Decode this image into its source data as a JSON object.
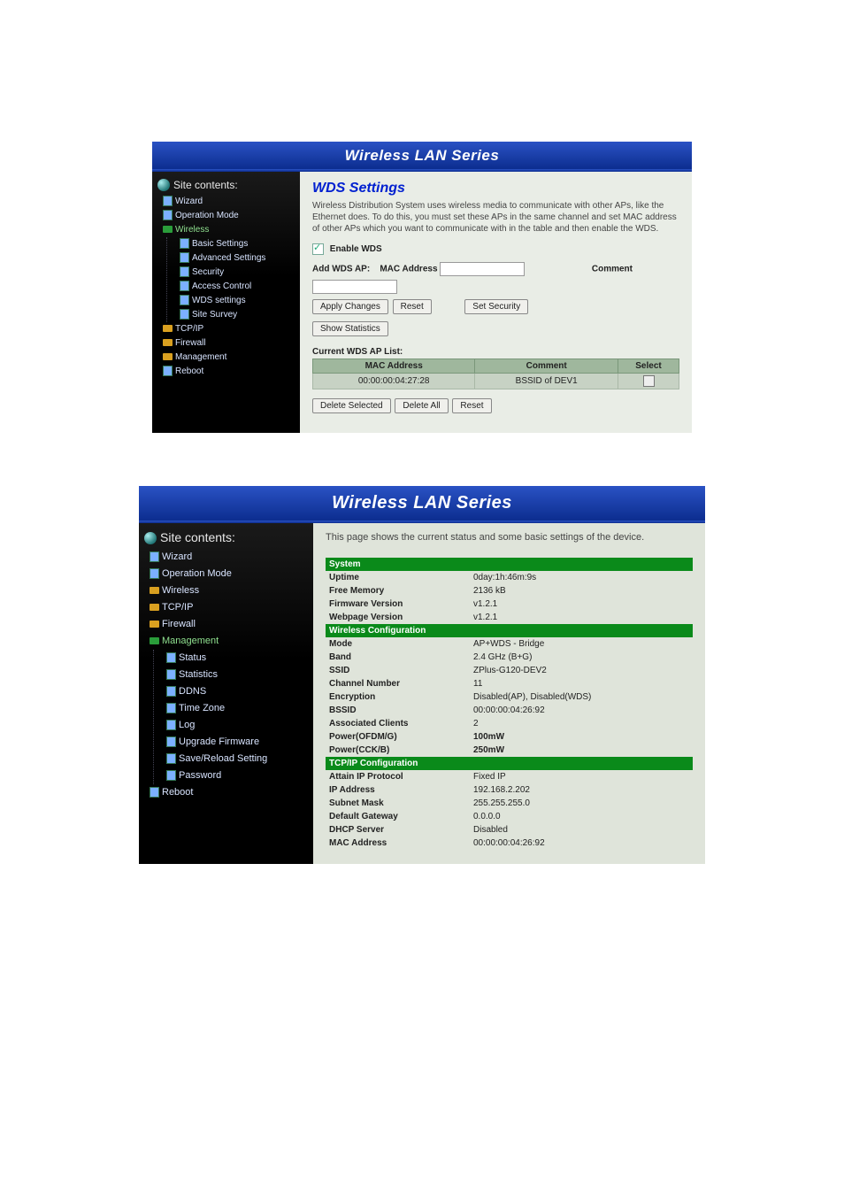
{
  "header": {
    "title": "Wireless LAN Series"
  },
  "wds": {
    "sidebar": {
      "header": "Site contents:",
      "items": [
        {
          "label": "Wizard",
          "kind": "doc"
        },
        {
          "label": "Operation Mode",
          "kind": "doc"
        },
        {
          "label": "Wireless",
          "kind": "folder-green",
          "children": [
            {
              "label": "Basic Settings",
              "kind": "doc"
            },
            {
              "label": "Advanced Settings",
              "kind": "doc"
            },
            {
              "label": "Security",
              "kind": "doc"
            },
            {
              "label": "Access Control",
              "kind": "doc"
            },
            {
              "label": "WDS settings",
              "kind": "doc"
            },
            {
              "label": "Site Survey",
              "kind": "doc"
            }
          ]
        },
        {
          "label": "TCP/IP",
          "kind": "folder"
        },
        {
          "label": "Firewall",
          "kind": "folder"
        },
        {
          "label": "Management",
          "kind": "folder"
        },
        {
          "label": "Reboot",
          "kind": "doc"
        }
      ]
    },
    "content": {
      "title": "WDS Settings",
      "description": "Wireless Distribution System uses wireless media to communicate with other APs, like the Ethernet does. To do this, you must set these APs in the same channel and set MAC address of other APs which you want to communicate with in the table and then enable the WDS.",
      "enable_label": "Enable WDS",
      "enable_checked": true,
      "add_label": "Add WDS AP:",
      "mac_label": "MAC Address",
      "comment_label": "Comment",
      "mac_value": "",
      "comment_value": "",
      "buttons": {
        "apply": "Apply Changes",
        "reset": "Reset",
        "security": "Set Security",
        "stats": "Show Statistics"
      },
      "list_title": "Current WDS AP List:",
      "table_headers": {
        "mac": "MAC Address",
        "comment": "Comment",
        "select": "Select"
      },
      "table_rows": [
        {
          "mac": "00:00:00:04:27:28",
          "comment": "BSSID of DEV1",
          "selected": false
        }
      ],
      "bottom_buttons": {
        "delete_selected": "Delete Selected",
        "delete_all": "Delete All",
        "reset": "Reset"
      }
    }
  },
  "status": {
    "sidebar": {
      "header": "Site contents:",
      "items": [
        {
          "label": "Wizard",
          "kind": "doc"
        },
        {
          "label": "Operation Mode",
          "kind": "doc"
        },
        {
          "label": "Wireless",
          "kind": "folder"
        },
        {
          "label": "TCP/IP",
          "kind": "folder"
        },
        {
          "label": "Firewall",
          "kind": "folder"
        },
        {
          "label": "Management",
          "kind": "folder-green",
          "children": [
            {
              "label": "Status",
              "kind": "doc"
            },
            {
              "label": "Statistics",
              "kind": "doc"
            },
            {
              "label": "DDNS",
              "kind": "doc"
            },
            {
              "label": "Time Zone",
              "kind": "doc"
            },
            {
              "label": "Log",
              "kind": "doc"
            },
            {
              "label": "Upgrade Firmware",
              "kind": "doc"
            },
            {
              "label": "Save/Reload Setting",
              "kind": "doc"
            },
            {
              "label": "Password",
              "kind": "doc"
            }
          ]
        },
        {
          "label": "Reboot",
          "kind": "doc"
        }
      ]
    },
    "content": {
      "intro": "This page shows the current status and some basic settings of the device.",
      "sections": [
        {
          "name": "System",
          "rows": [
            {
              "k": "Uptime",
              "v": "0day:1h:46m:9s"
            },
            {
              "k": "Free Memory",
              "v": "2136 kB"
            },
            {
              "k": "Firmware Version",
              "v": "v1.2.1"
            },
            {
              "k": "Webpage Version",
              "v": "v1.2.1"
            }
          ]
        },
        {
          "name": "Wireless Configuration",
          "rows": [
            {
              "k": "Mode",
              "v": "AP+WDS - Bridge"
            },
            {
              "k": "Band",
              "v": "2.4 GHz (B+G)"
            },
            {
              "k": "SSID",
              "v": "ZPlus-G120-DEV2"
            },
            {
              "k": "Channel Number",
              "v": "11"
            },
            {
              "k": "Encryption",
              "v": "Disabled(AP), Disabled(WDS)"
            },
            {
              "k": "BSSID",
              "v": "00:00:00:04:26:92"
            },
            {
              "k": "Associated Clients",
              "v": "2"
            },
            {
              "k": "Power(OFDM/G)",
              "v": "100mW",
              "bold": true
            },
            {
              "k": "Power(CCK/B)",
              "v": "250mW",
              "bold": true
            }
          ]
        },
        {
          "name": "TCP/IP Configuration",
          "rows": [
            {
              "k": "Attain IP Protocol",
              "v": "Fixed IP"
            },
            {
              "k": "IP Address",
              "v": "192.168.2.202"
            },
            {
              "k": "Subnet Mask",
              "v": "255.255.255.0"
            },
            {
              "k": "Default Gateway",
              "v": "0.0.0.0"
            },
            {
              "k": "DHCP Server",
              "v": "Disabled"
            },
            {
              "k": "MAC Address",
              "v": "00:00:00:04:26:92"
            }
          ]
        }
      ]
    }
  }
}
